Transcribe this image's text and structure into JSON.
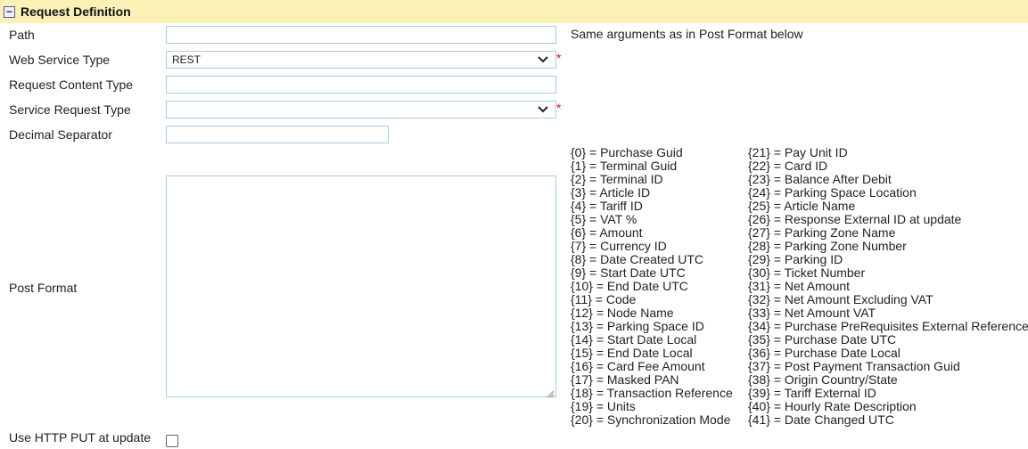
{
  "section": {
    "title": "Request Definition",
    "icon": "minus-box-icon"
  },
  "fields": {
    "path_label": "Path",
    "path_value": "",
    "path_hint": "Same arguments as in Post Format below",
    "ws_type_label": "Web Service Type",
    "ws_type_value": "REST",
    "req_content_type_label": "Request Content Type",
    "req_content_type_value": "",
    "service_req_type_label": "Service Request Type",
    "service_req_type_value": "",
    "decimal_sep_label": "Decimal Separator",
    "decimal_sep_value": "",
    "post_format_label": "Post Format",
    "put_label": "Use HTTP PUT at update",
    "required_mark": "*"
  },
  "args_left": [
    "{0} = Purchase Guid",
    "{1} = Terminal Guid",
    "{2} = Terminal ID",
    "{3} = Article ID",
    "{4} = Tariff ID",
    "{5} = VAT %",
    "{6} = Amount",
    "{7} = Currency ID",
    "{8} = Date Created UTC",
    "{9} = Start Date UTC",
    "{10} = End Date UTC",
    "{11} = Code",
    "{12} = Node Name",
    "{13} = Parking Space ID",
    "{14} = Start Date Local",
    "{15} = End Date Local",
    "{16} = Card Fee Amount",
    "{17} = Masked PAN",
    "{18} = Transaction Reference",
    "{19} = Units",
    "{20} = Synchronization Mode"
  ],
  "args_right": [
    "{21} = Pay Unit ID",
    "{22} = Card ID",
    "{23} = Balance After Debit",
    "{24} = Parking Space Location",
    "{25} = Article Name",
    "{26} = Response External ID at update",
    "{27} = Parking Zone Name",
    "{28} = Parking Zone Number",
    "{29} = Parking ID",
    "{30} = Ticket Number",
    "{31} = Net Amount",
    "{32} = Net Amount Excluding VAT",
    "{33} = Net Amount VAT",
    "{34} = Purchase PreRequisites External Reference",
    "{35} = Purchase Date UTC",
    "{36} = Purchase Date Local",
    "{37} = Post Payment Transaction Guid",
    "{38} = Origin Country/State",
    "{39} = Tariff External ID",
    "{40} = Hourly Rate Description",
    "{41} = Date Changed UTC"
  ]
}
